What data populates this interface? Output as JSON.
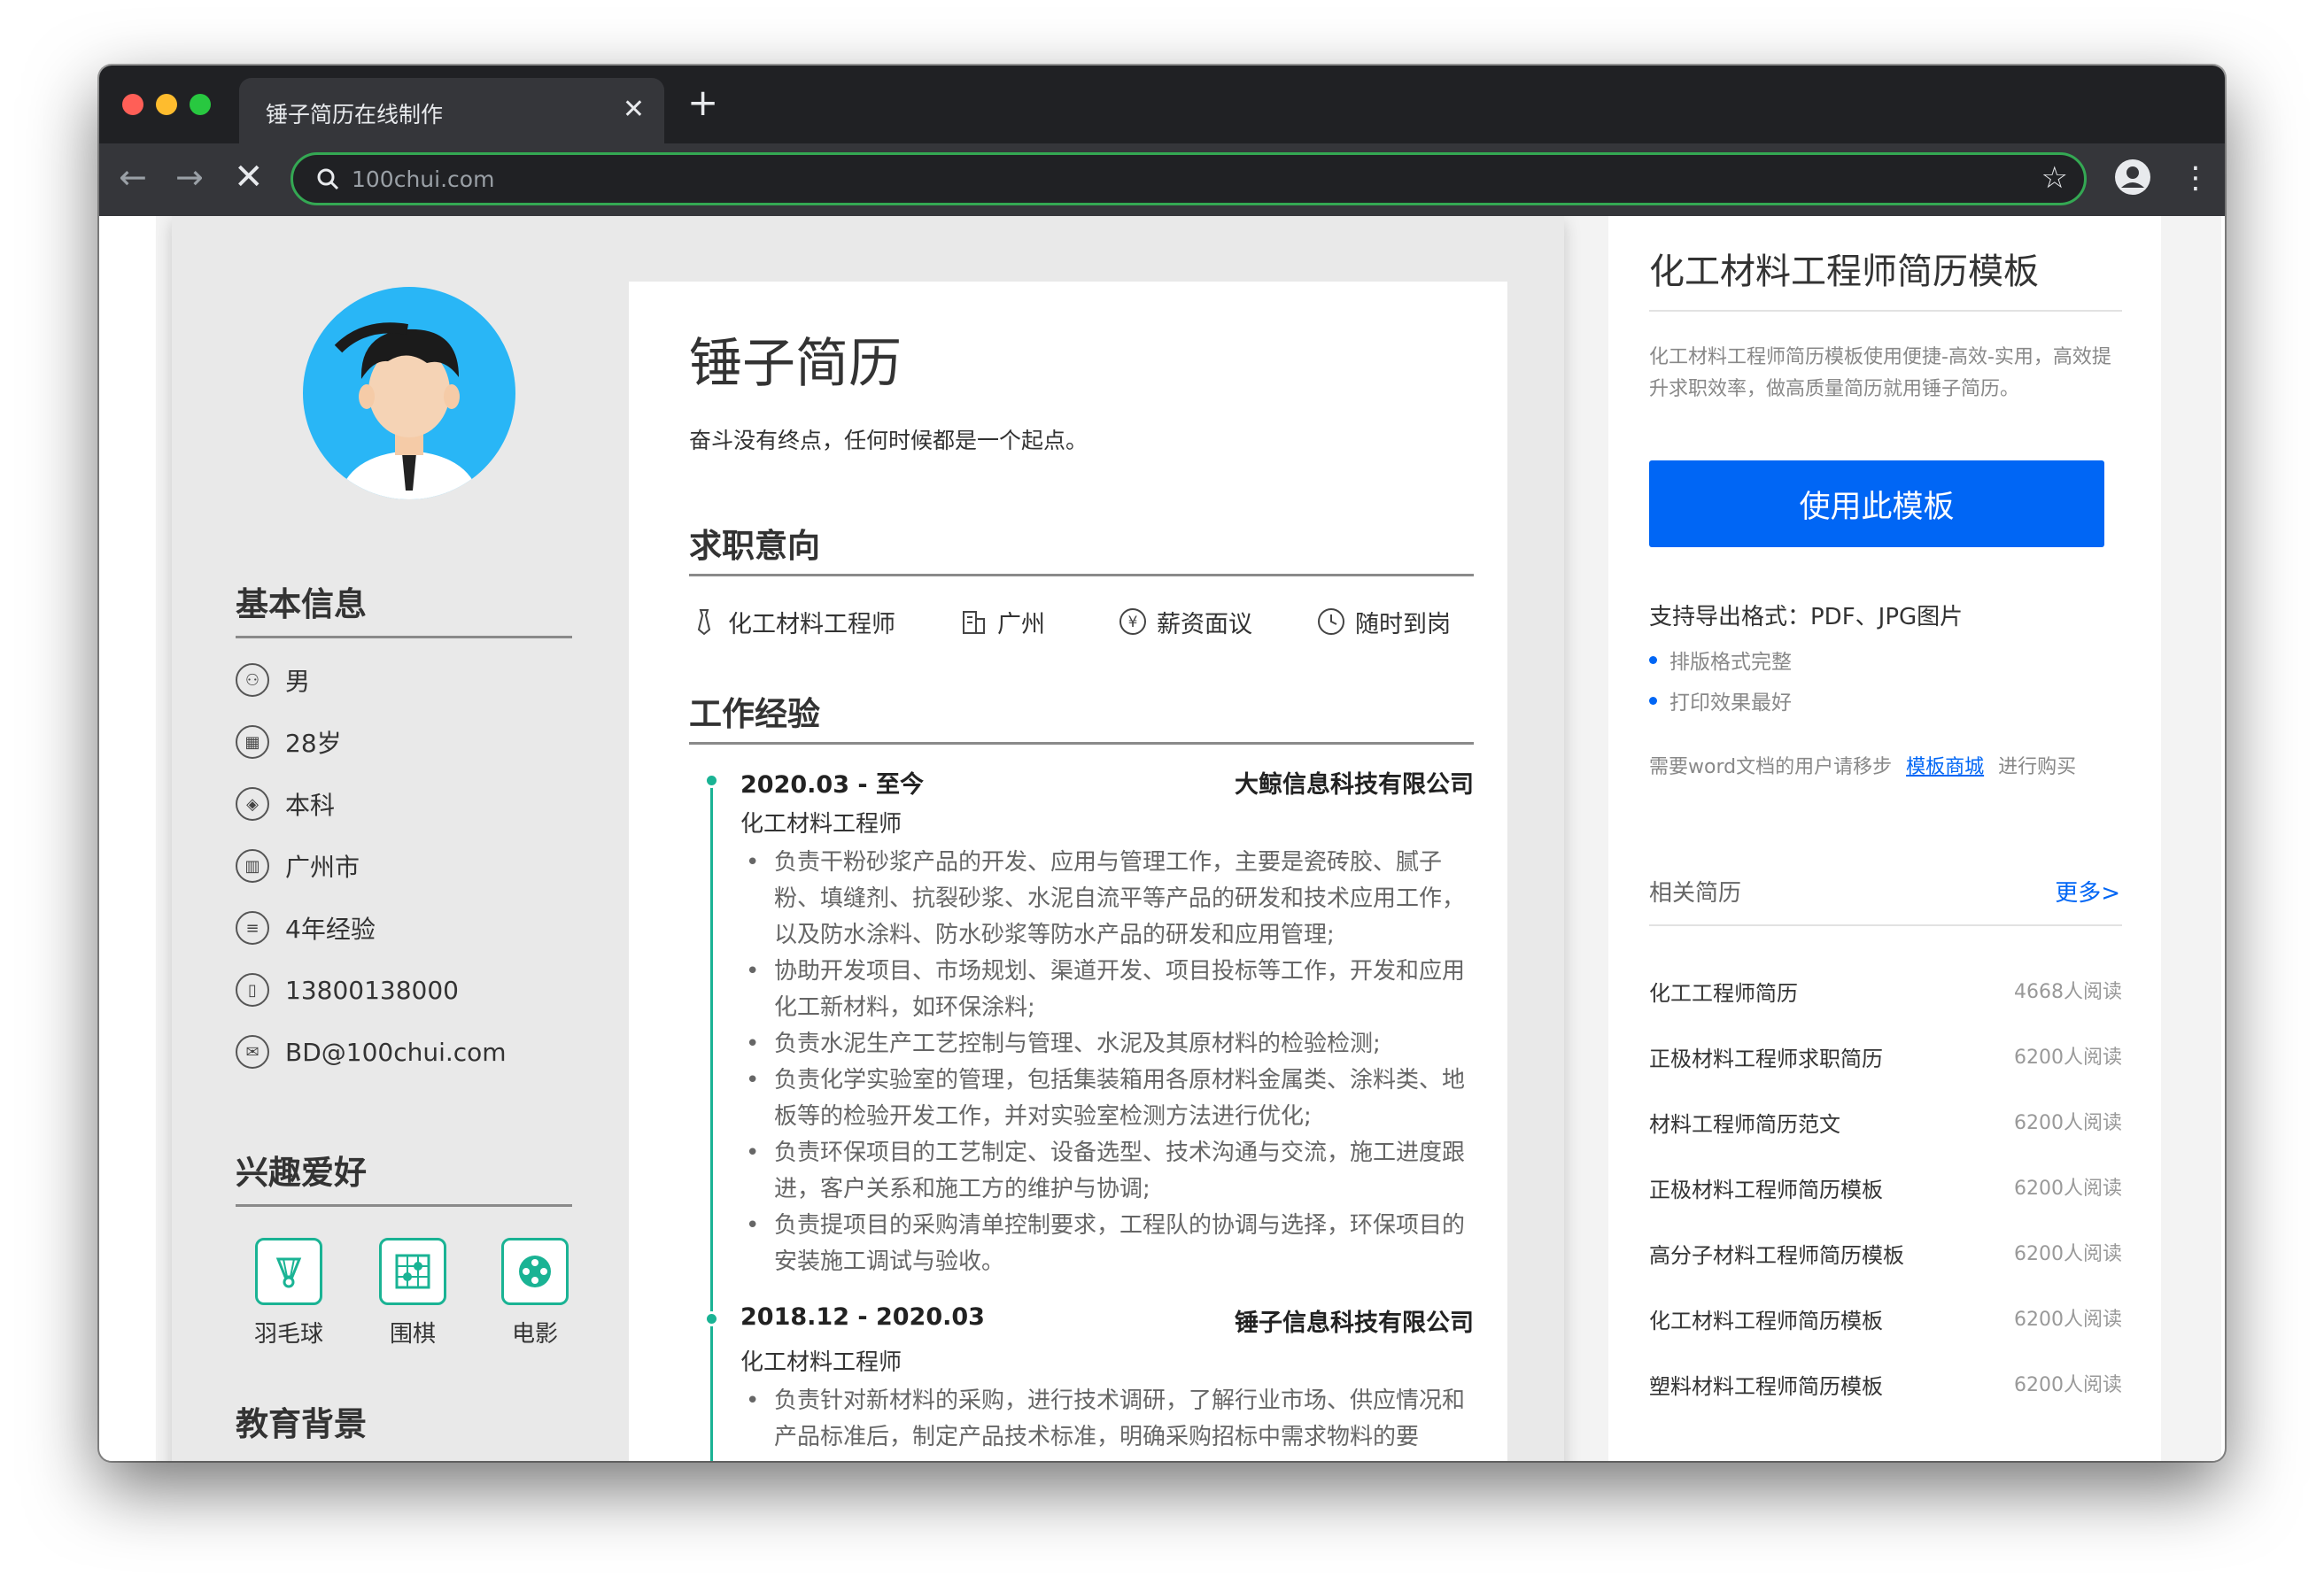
{
  "browser": {
    "tab_title": "锤子简历在线制作",
    "url": "100chui.com",
    "new_tab": "+",
    "close_tab": "✕"
  },
  "resume": {
    "left": {
      "basic_title": "基本信息",
      "basic_items": [
        {
          "icon": "gender-icon",
          "text": "男"
        },
        {
          "icon": "calendar-icon",
          "text": "28岁"
        },
        {
          "icon": "graduation-icon",
          "text": "本科"
        },
        {
          "icon": "building-icon",
          "text": "广州市"
        },
        {
          "icon": "document-icon",
          "text": "4年经验"
        },
        {
          "icon": "phone-icon",
          "text": "13800138000"
        },
        {
          "icon": "mail-icon",
          "text": "BD@100chui.com"
        }
      ],
      "hobby_title": "兴趣爱好",
      "hobbies": [
        {
          "icon": "badminton-icon",
          "label": "羽毛球"
        },
        {
          "icon": "go-board-icon",
          "label": "围棋"
        },
        {
          "icon": "film-reel-icon",
          "label": "电影"
        }
      ],
      "edu_title": "教育背景"
    },
    "right": {
      "name": "锤子简历",
      "motto": "奋斗没有终点，任何时候都是一个起点。",
      "intent_title": "求职意向",
      "intent": [
        {
          "icon": "tie-icon",
          "text": "化工材料工程师"
        },
        {
          "icon": "building-icon",
          "text": "广州"
        },
        {
          "icon": "yen-icon",
          "text": "薪资面议"
        },
        {
          "icon": "clock-icon",
          "text": "随时到岗"
        }
      ],
      "work_title": "工作经验",
      "jobs": [
        {
          "date": "2020.03 - 至今",
          "company": "大鲸信息科技有限公司",
          "title": "化工材料工程师",
          "duties": [
            "负责干粉砂浆产品的开发、应用与管理工作，主要是瓷砖胶、腻子粉、填缝剂、抗裂砂浆、水泥自流平等产品的研发和技术应用工作，以及防水涂料、防水砂浆等防水产品的研发和应用管理;",
            "协助开发项目、市场规划、渠道开发、项目投标等工作，开发和应用化工新材料，如环保涂料;",
            "负责水泥生产工艺控制与管理、水泥及其原材料的检验检测;",
            "负责化学实验室的管理，包括集装箱用各原材料金属类、涂料类、地板等的检验开发工作，并对实验室检测方法进行优化;",
            "负责环保项目的工艺制定、设备选型、技术沟通与交流，施工进度跟进，客户关系和施工方的维护与协调;",
            "负责提项目的采购清单控制要求，工程队的协调与选择，环保项目的安装施工调试与验收。"
          ]
        },
        {
          "date": "2018.12 - 2020.03",
          "company": "锤子信息科技有限公司",
          "title": "化工材料工程师",
          "duties": [
            "负责针对新材料的采购，进行技术调研，了解行业市场、供应情况和产品标准后，制定产品技术标准，明确采购招标中需求物料的要"
          ]
        }
      ]
    }
  },
  "sidebar": {
    "title": "化工材料工程师简历模板",
    "description": "化工材料工程师简历模板使用便捷-高效-实用，高效提升求职效率，做高质量简历就用锤子简历。",
    "use_button": "使用此模板",
    "formats": "支持导出格式：PDF、JPG图片",
    "bullets": [
      "排版格式完整",
      "打印效果最好"
    ],
    "note_before": "需要word文档的用户请移步",
    "note_link": "模板商城",
    "note_after": "进行购买",
    "related_title": "相关简历",
    "more": "更多>",
    "related": [
      {
        "name": "化工工程师简历",
        "reads": "4668人阅读"
      },
      {
        "name": "正极材料工程师求职简历",
        "reads": "6200人阅读"
      },
      {
        "name": "材料工程师简历范文",
        "reads": "6200人阅读"
      },
      {
        "name": "正极材料工程师简历模板",
        "reads": "6200人阅读"
      },
      {
        "name": "高分子材料工程师简历模板",
        "reads": "6200人阅读"
      },
      {
        "name": "化工材料工程师简历模板",
        "reads": "6200人阅读"
      },
      {
        "name": "塑料材料工程师简历模板",
        "reads": "6200人阅读"
      }
    ]
  },
  "colors": {
    "accent": "#1ab394",
    "brand_blue": "#0066f5",
    "avatar_bg": "#29b6f6"
  }
}
